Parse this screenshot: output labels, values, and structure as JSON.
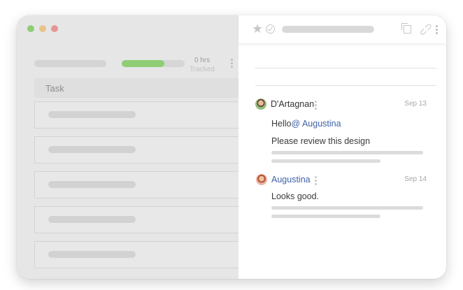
{
  "tracker": {
    "hours_value": "0 hrs",
    "hours_label": "Tracked",
    "progress_fraction": 0.68,
    "column_task": "Task"
  },
  "comments": [
    {
      "author": "D'Artagnan",
      "date": "Sep 13",
      "greeting": "Hello",
      "mention": "@ Augustina",
      "body": "Please review this design"
    },
    {
      "author": "Augustina",
      "date": "Sep 14",
      "body": "Looks good."
    }
  ],
  "colors": {
    "accent_green": "#8fce74",
    "mention_blue": "#3f62a8"
  },
  "icons": [
    "star-icon",
    "check-circle-icon",
    "copy-icon",
    "link-icon",
    "more-icon"
  ]
}
